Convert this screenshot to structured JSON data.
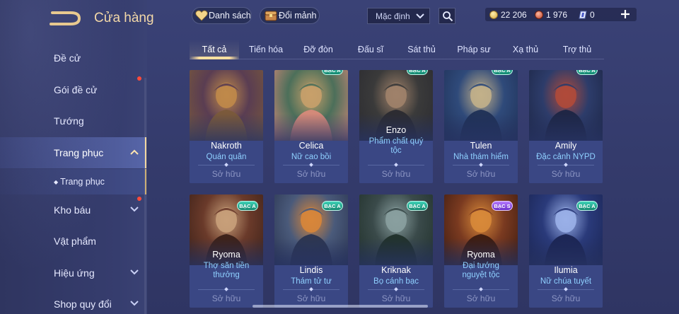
{
  "header": {
    "title": "Cửa hàng"
  },
  "sidebar": {
    "items": [
      {
        "label": "Đề cử"
      },
      {
        "label": "Gói đề cử"
      },
      {
        "label": "Tướng"
      },
      {
        "label": "Trang phục"
      },
      {
        "label": "Trang phục",
        "prefix": "◆"
      },
      {
        "label": "Kho báu"
      },
      {
        "label": "Vật phẩm"
      },
      {
        "label": "Hiệu ứng"
      },
      {
        "label": "Shop quy đổi"
      }
    ]
  },
  "topbar": {
    "list_label": "Danh sách",
    "exchange_label": "Đổi mảnh",
    "sort_value": "Mặc định",
    "currency": {
      "gold": "22 206",
      "gems": "1 976",
      "vouchers": "0"
    }
  },
  "tabs": [
    "Tất cả",
    "Tiến hóa",
    "Đỡ đòn",
    "Đấu sĩ",
    "Sát thủ",
    "Pháp sư",
    "Xạ thủ",
    "Trợ thủ"
  ],
  "owned_label": "Sở hữu",
  "cards": [
    {
      "hero": "Nakroth",
      "skin": "Quán quân",
      "tier": "",
      "colors": [
        "#5a3d52",
        "#c08a4a",
        "#7a5a3a"
      ]
    },
    {
      "hero": "Celica",
      "skin": "Nữ cao bồi",
      "tier": "BẠC A",
      "colors": [
        "#4c6f5a",
        "#c8a06a",
        "#d88a7a"
      ]
    },
    {
      "hero": "Enzo",
      "skin": "Phẩm chất quý tộc",
      "tier": "BẠC A",
      "colors": [
        "#3a3a3a",
        "#a0826a",
        "#2a2a30"
      ]
    },
    {
      "hero": "Tulen",
      "skin": "Nhà thám hiểm",
      "tier": "BẠC A",
      "colors": [
        "#2f4a7a",
        "#c2b08a",
        "#1f3056"
      ]
    },
    {
      "hero": "Amily",
      "skin": "Đặc cảnh NYPD",
      "tier": "BẠC A",
      "colors": [
        "#2d3c6a",
        "#b04a3a",
        "#1c2544"
      ]
    },
    {
      "hero": "Ryoma",
      "skin": "Thợ săn tiền thưởng",
      "tier": "BẠC A",
      "colors": [
        "#6a3a2a",
        "#c8a07a",
        "#3a2018"
      ]
    },
    {
      "hero": "Lindis",
      "skin": "Thám tử tư",
      "tier": "BẠC A",
      "colors": [
        "#4a5a7a",
        "#d8863a",
        "#2a3450"
      ]
    },
    {
      "hero": "Kriknak",
      "skin": "Bọ cánh bạc",
      "tier": "BẠC A",
      "colors": [
        "#3a4a4a",
        "#8aa0a0",
        "#20302a"
      ]
    },
    {
      "hero": "Ryoma",
      "skin": "Đại tướng nguyệt tộc",
      "tier": "BẠC S",
      "colors": [
        "#7a3a20",
        "#d88a3a",
        "#3a1a10"
      ]
    },
    {
      "hero": "Ilumia",
      "skin": "Nữ chúa tuyết",
      "tier": "BẠC A",
      "colors": [
        "#2a3a7a",
        "#9ab0e8",
        "#1a2452"
      ]
    }
  ]
}
